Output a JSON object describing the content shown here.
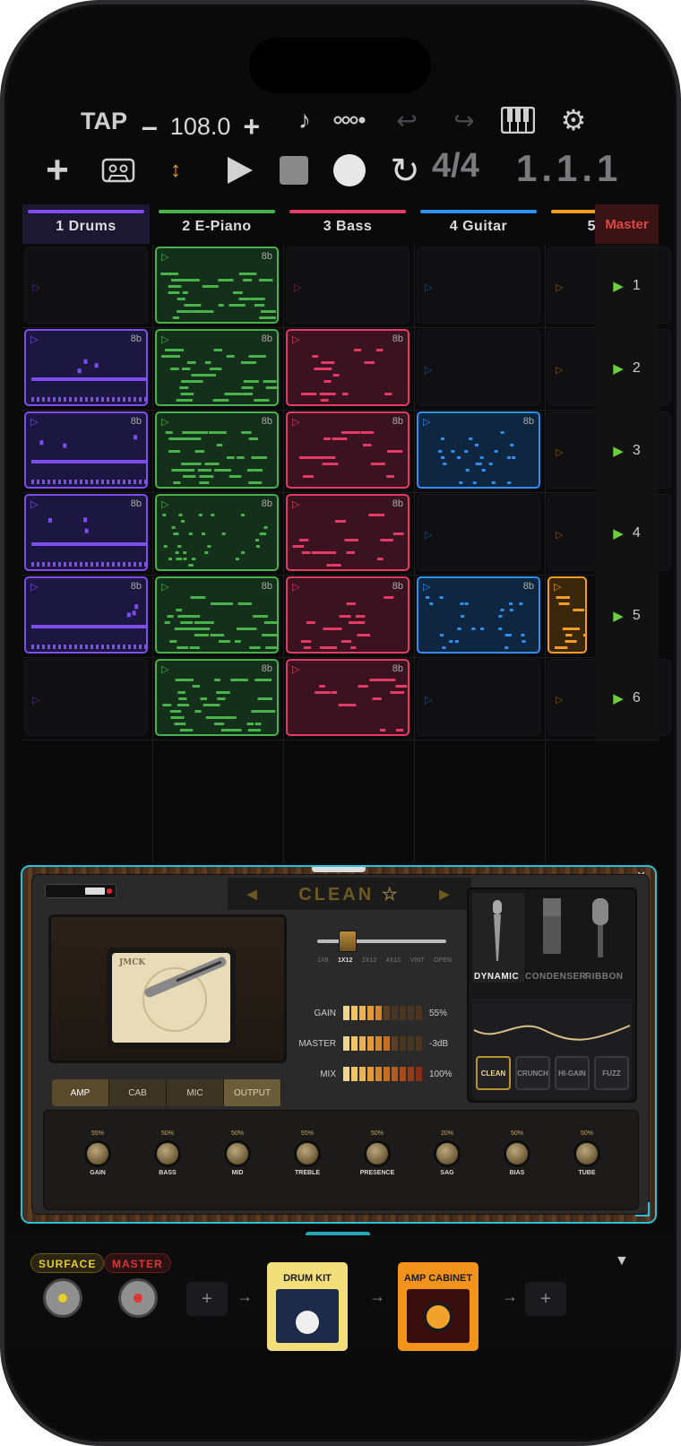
{
  "toolbar": {
    "tap_label": "TAP",
    "tempo_minus": "–",
    "tempo_value": "108.0",
    "tempo_plus": "+",
    "time_signature": "4/4",
    "position": "1.1.1"
  },
  "tracks": [
    {
      "label": "1 Drums",
      "color": "#7d4df0"
    },
    {
      "label": "2 E-Piano",
      "color": "#49b24b"
    },
    {
      "label": "3 Bass",
      "color": "#e33a66"
    },
    {
      "label": "4 Guitar",
      "color": "#2f8ff0"
    },
    {
      "label": "5",
      "color": "#f39c24"
    }
  ],
  "master_label": "Master",
  "scenes": [
    "1",
    "2",
    "3",
    "4",
    "5",
    "6"
  ],
  "clip_length": "8b",
  "amp": {
    "preset_name": "CLEAN",
    "cab_logo": "JMCK",
    "cab_sizes": [
      "1X8",
      "1X12",
      "2X12",
      "4X12",
      "VINT",
      "OPEN"
    ],
    "tabs": [
      "AMP",
      "CAB",
      "MIC",
      "OUTPUT"
    ],
    "meters": [
      {
        "label": "GAIN",
        "value": "55%"
      },
      {
        "label": "MASTER",
        "value": "-3dB"
      },
      {
        "label": "MIX",
        "value": "100%"
      }
    ],
    "mics": [
      "DYNAMIC",
      "CONDENSER",
      "RIBBON"
    ],
    "modes": [
      "CLEAN",
      "CRUNCH",
      "HI-GAIN",
      "FUZZ"
    ],
    "knobs": [
      {
        "label": "GAIN",
        "value": "55%"
      },
      {
        "label": "BASS",
        "value": "50%"
      },
      {
        "label": "MID",
        "value": "50%"
      },
      {
        "label": "TREBLE",
        "value": "55%"
      },
      {
        "label": "PRESENCE",
        "value": "50%"
      },
      {
        "label": "SAG",
        "value": "20%"
      },
      {
        "label": "BIAS",
        "value": "50%"
      },
      {
        "label": "TUBE",
        "value": "50%"
      }
    ]
  },
  "chain": {
    "surface_label": "SURFACE",
    "master_label": "MASTER",
    "add_label": "+",
    "drum_kit_label": "DRUM KIT",
    "amp_cabinet_label": "AMP CABINET"
  }
}
